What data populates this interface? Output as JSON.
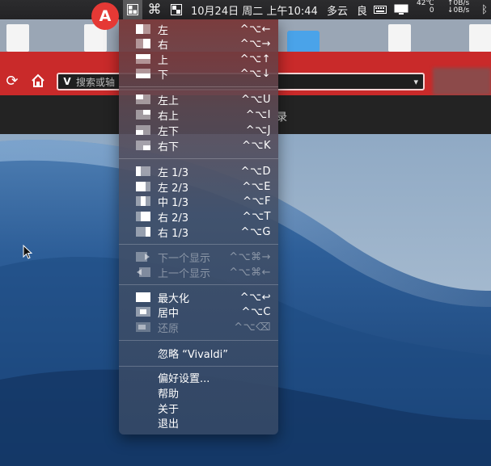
{
  "menubar": {
    "date_time": "10月24日 周二 上午10:44",
    "weather": "多云",
    "air_quality": "良",
    "temperature": "42℃",
    "temp_sub": "0",
    "net_up": "↑0B/s",
    "net_down": "↓0B/s"
  },
  "avatar": {
    "letter": "A",
    "color": "#e53935"
  },
  "browser": {
    "address_prefix": "V",
    "address_placeholder": "搜索或轴",
    "dropdown_glyph": "▾",
    "subbar_text": "录"
  },
  "menu": {
    "items": [
      {
        "label": "左",
        "shortcut": "^⌥←",
        "icon": "half-left",
        "enabled": true
      },
      {
        "label": "右",
        "shortcut": "^⌥→",
        "icon": "half-right",
        "enabled": true
      },
      {
        "label": "上",
        "shortcut": "^⌥↑",
        "icon": "half-top",
        "enabled": true
      },
      {
        "label": "下",
        "shortcut": "^⌥↓",
        "icon": "half-bottom",
        "enabled": true
      },
      {
        "label": "左上",
        "shortcut": "^⌥U",
        "icon": "quarter-top-left",
        "enabled": true
      },
      {
        "label": "右上",
        "shortcut": "^⌥I",
        "icon": "quarter-top-right",
        "enabled": true
      },
      {
        "label": "左下",
        "shortcut": "^⌥J",
        "icon": "quarter-bottom-left",
        "enabled": true
      },
      {
        "label": "右下",
        "shortcut": "^⌥K",
        "icon": "quarter-bottom-right",
        "enabled": true
      },
      {
        "label": "左 1/3",
        "shortcut": "^⌥D",
        "icon": "third-left",
        "enabled": true
      },
      {
        "label": "左 2/3",
        "shortcut": "^⌥E",
        "icon": "two-thirds-left",
        "enabled": true
      },
      {
        "label": "中 1/3",
        "shortcut": "^⌥F",
        "icon": "third-center",
        "enabled": true
      },
      {
        "label": "右 2/3",
        "shortcut": "^⌥T",
        "icon": "two-thirds-right",
        "enabled": true
      },
      {
        "label": "右 1/3",
        "shortcut": "^⌥G",
        "icon": "third-right",
        "enabled": true
      },
      {
        "label": "下一个显示",
        "shortcut": "^⌥⌘→",
        "icon": "next-display",
        "enabled": false
      },
      {
        "label": "上一个显示",
        "shortcut": "^⌥⌘←",
        "icon": "prev-display",
        "enabled": false
      },
      {
        "label": "最大化",
        "shortcut": "^⌥↩",
        "icon": "maximize",
        "enabled": true
      },
      {
        "label": "居中",
        "shortcut": "^⌥C",
        "icon": "center",
        "enabled": true
      },
      {
        "label": "还原",
        "shortcut": "^⌥⌫",
        "icon": "restore",
        "enabled": false
      },
      {
        "label": "忽略 “Vivaldi”",
        "shortcut": "",
        "icon": "",
        "enabled": true
      },
      {
        "label": "偏好设置...",
        "shortcut": "",
        "icon": "",
        "enabled": true
      },
      {
        "label": "帮助",
        "shortcut": "",
        "icon": "",
        "enabled": true
      },
      {
        "label": "关于",
        "shortcut": "",
        "icon": "",
        "enabled": true
      },
      {
        "label": "退出",
        "shortcut": "",
        "icon": "",
        "enabled": true
      }
    ]
  }
}
